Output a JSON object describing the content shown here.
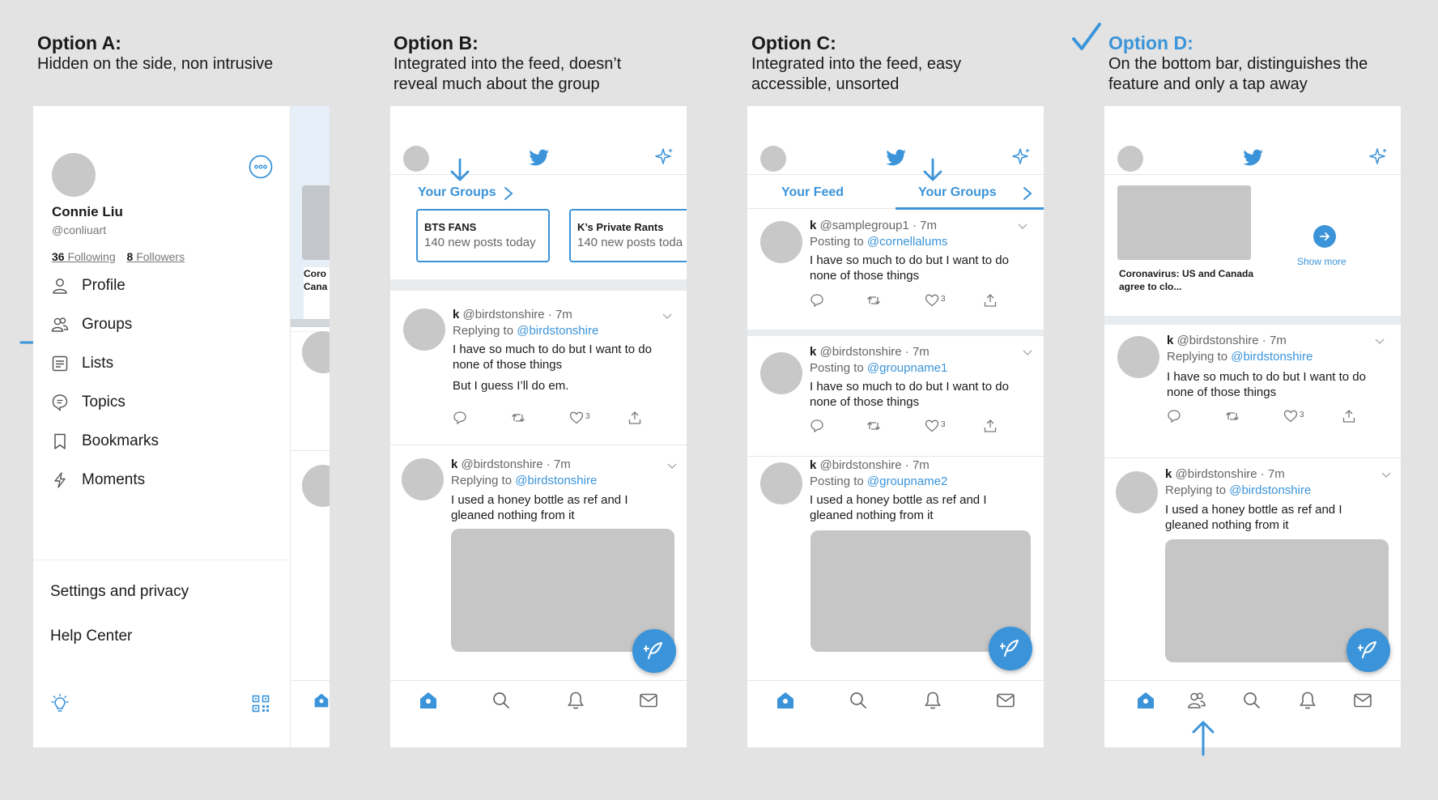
{
  "options": [
    {
      "title": "Option A:",
      "desc": [
        "Hidden on the side, non intrusive"
      ]
    },
    {
      "title": "Option B:",
      "desc": [
        "Integrated into the feed, doesn’t",
        "reveal much about the group"
      ]
    },
    {
      "title": "Option C:",
      "desc": [
        "Integrated into the feed, easy",
        "accessible, unsorted"
      ]
    },
    {
      "title": "Option D:",
      "desc": [
        "On the bottom bar, distinguishes the",
        "feature and only a tap away"
      ]
    }
  ],
  "accent": "#3b94d9",
  "drawer": {
    "name": "Connie Liu",
    "handle": "@conliuart",
    "following_count": "36",
    "following_label": "Following",
    "followers_count": "8",
    "followers_label": "Followers",
    "menu": [
      "Profile",
      "Groups",
      "Lists",
      "Topics",
      "Bookmarks",
      "Moments"
    ],
    "secondary": [
      "Settings and privacy",
      "Help Center"
    ],
    "peek_text": [
      "Coro",
      "Cana"
    ]
  },
  "b": {
    "groups_link": "Your Groups",
    "cards": [
      {
        "name": "BTS FANS",
        "count": "140 new posts today"
      },
      {
        "name": "K’s Private Rants",
        "count": "140 new posts toda"
      }
    ],
    "tweets": [
      {
        "name": "k",
        "handle": "@birdstonshire · 7m",
        "rep_label": "Replying to",
        "rep_handle": "@birdstonshire",
        "body1": "I have so much to do but I want to do none of those things",
        "body2": "But I guess I’ll do em.",
        "likes": "3"
      },
      {
        "name": "k",
        "handle": "@birdstonshire · 7m",
        "rep_label": "Replying to",
        "rep_handle": "@birdstonshire",
        "body1": "I used a honey bottle as ref and I gleaned nothing from it"
      }
    ]
  },
  "c": {
    "tab_feed": "Your Feed",
    "tab_groups": "Your Groups",
    "tweets": [
      {
        "name": "k",
        "handle": "@samplegroup1 · 7m",
        "rep_label": "Posting to",
        "rep_handle": "@cornellalums",
        "body1": "I have so much to do but I want to do none of those things",
        "likes": "3"
      },
      {
        "name": "k",
        "handle": "@birdstonshire · 7m",
        "rep_label": "Posting to",
        "rep_handle": "@groupname1",
        "body1": "I have so much to do but I want to do none of those things",
        "likes": "3"
      },
      {
        "name": "k",
        "handle": "@birdstonshire · 7m",
        "rep_label": "Posting to",
        "rep_handle": "@groupname2",
        "body1": "I used a honey bottle as ref and I gleaned nothing from it"
      }
    ]
  },
  "d": {
    "news_caption": "Coronavirus: US and Canada agree to clo...",
    "show_more": "Show more",
    "tweets": [
      {
        "name": "k",
        "handle": "@birdstonshire · 7m",
        "rep_label": "Replying to",
        "rep_handle": "@birdstonshire",
        "body1": "I have so much to do but I want to do none of those things",
        "likes": "3"
      },
      {
        "name": "k",
        "handle": "@birdstonshire · 7m",
        "rep_label": "Replying to",
        "rep_handle": "@birdstonshire",
        "body1": "I used a honey bottle as ref and I gleaned nothing from it"
      }
    ]
  }
}
